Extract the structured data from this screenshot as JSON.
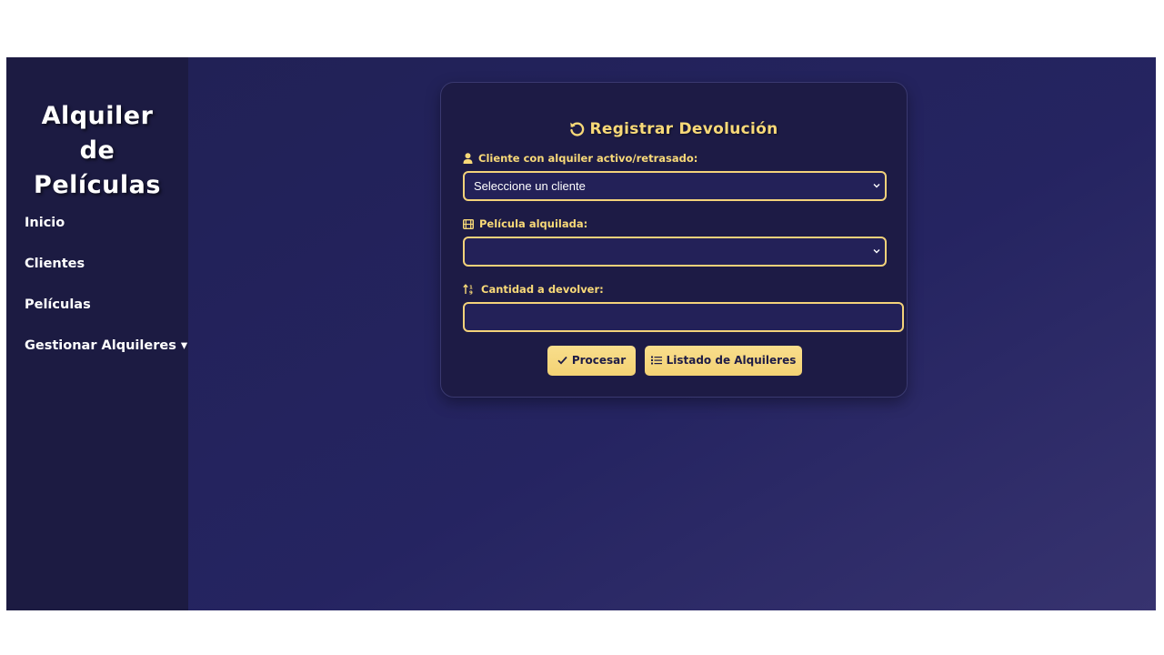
{
  "sidebar": {
    "brand": "Alquiler de Películas",
    "nav": [
      {
        "label": "Inicio"
      },
      {
        "label": "Clientes"
      },
      {
        "label": "Películas"
      },
      {
        "label": "Gestionar Alquileres ▾"
      }
    ]
  },
  "form": {
    "title": "Registrar Devolución",
    "title_icon": "rotate-left-icon",
    "cliente": {
      "label": "Cliente con alquiler activo/retrasado:",
      "icon": "user-icon",
      "selected": "Seleccione un cliente"
    },
    "pelicula": {
      "label": "Película alquilada:",
      "icon": "film-icon",
      "selected": ""
    },
    "cantidad": {
      "label": "Cantidad a devolver:",
      "icon": "sort-numeric-icon",
      "value": ""
    },
    "buttons": {
      "procesar": "Procesar",
      "listado": "Listado de Alquileres"
    }
  },
  "colors": {
    "accent": "#f8d978",
    "sidebar_bg": "#1c1b42",
    "main_bg": "#252461",
    "card_bg": "#1d1b45"
  }
}
